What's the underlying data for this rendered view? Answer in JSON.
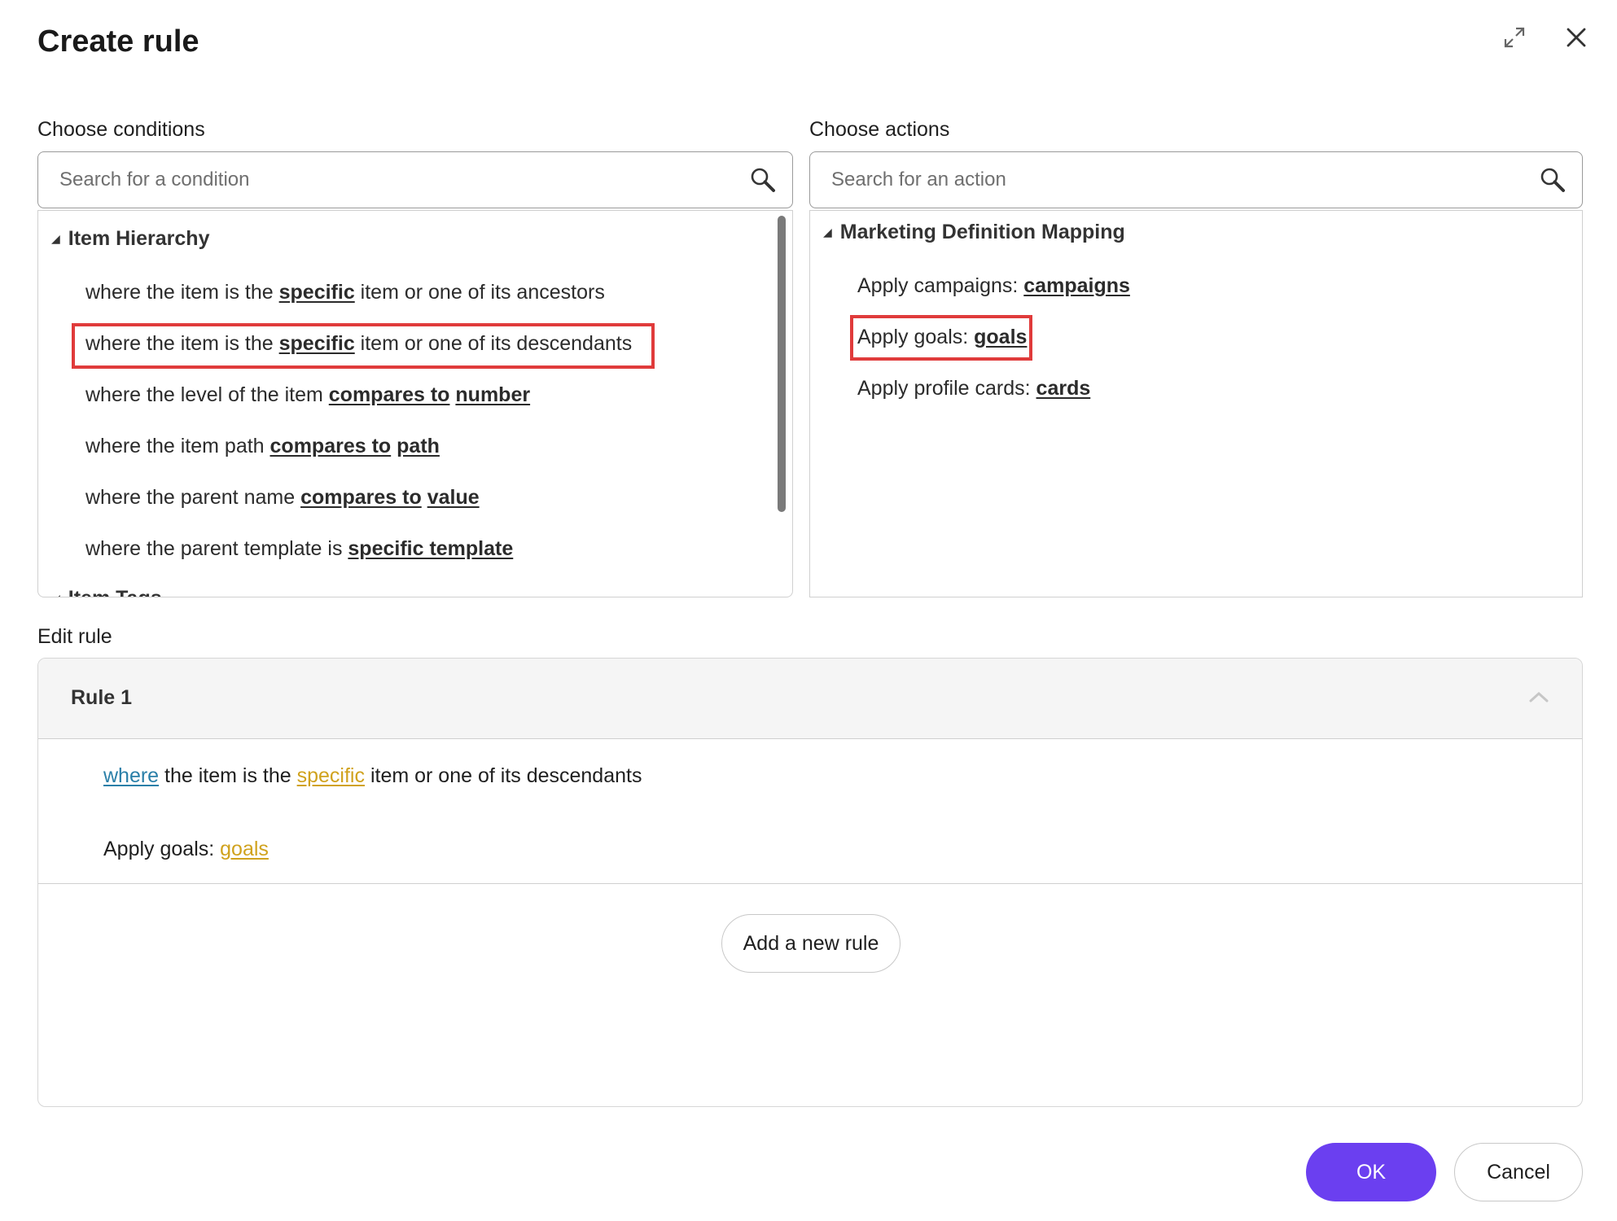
{
  "dialog": {
    "title": "Create rule"
  },
  "conditions": {
    "label": "Choose conditions",
    "search_placeholder": "Search for a condition",
    "group1": {
      "name": "Item Hierarchy",
      "items": [
        {
          "pre": "where the item is the ",
          "kw1": "specific",
          "mid": " item or one of its ancestors",
          "kw2": "",
          "post": ""
        },
        {
          "pre": "where the item is the ",
          "kw1": "specific",
          "mid": " item or one of its descendants",
          "kw2": "",
          "post": ""
        },
        {
          "pre": "where the level of the item ",
          "kw1": "compares to",
          "mid": " ",
          "kw2": "number",
          "post": ""
        },
        {
          "pre": "where the item path ",
          "kw1": "compares to",
          "mid": " ",
          "kw2": "path",
          "post": ""
        },
        {
          "pre": "where the parent name ",
          "kw1": "compares to",
          "mid": " ",
          "kw2": "value",
          "post": ""
        },
        {
          "pre": "where the parent template is ",
          "kw1": "specific template",
          "mid": "",
          "kw2": "",
          "post": ""
        }
      ]
    },
    "group2": {
      "name": "Item Tags"
    }
  },
  "actions": {
    "label": "Choose actions",
    "search_placeholder": "Search for an action",
    "group1": {
      "name": "Marketing Definition Mapping",
      "items": [
        {
          "pre": "Apply campaigns: ",
          "kw": "campaigns"
        },
        {
          "pre": "Apply goals: ",
          "kw": "goals"
        },
        {
          "pre": "Apply profile cards: ",
          "kw": "cards"
        }
      ]
    }
  },
  "edit_rule": {
    "label": "Edit rule",
    "rule_title": "Rule 1",
    "condition_line": {
      "link1": "where",
      "text1": " the item is the ",
      "link2": "specific",
      "text2": " item or one of its descendants"
    },
    "action_line": {
      "text": "Apply goals: ",
      "link": "goals"
    },
    "add_rule_label": "Add a new rule"
  },
  "footer": {
    "ok_label": "OK",
    "cancel_label": "Cancel"
  },
  "colors": {
    "accent": "#6b3ff0",
    "highlight": "#e03b3b",
    "link_blue": "#2a7fa8",
    "link_gold": "#d0a21e"
  }
}
